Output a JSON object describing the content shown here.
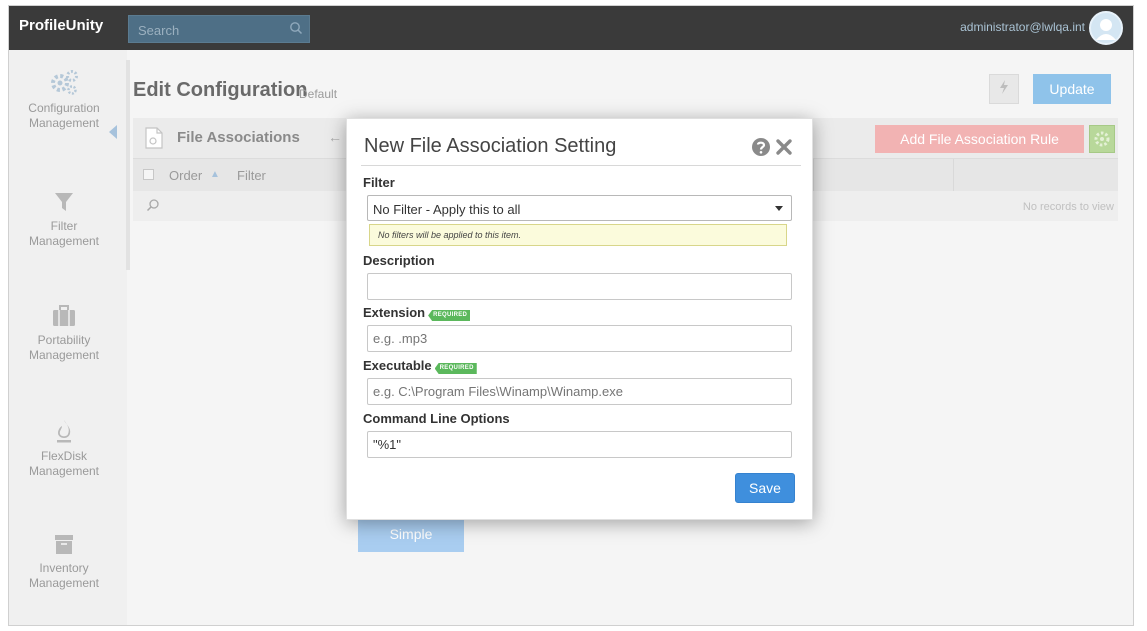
{
  "app": {
    "brand": "ProfileUnity",
    "search_placeholder": "Search",
    "user": "administrator@lwlqa.int"
  },
  "sidebar": {
    "items": [
      {
        "label_line1": "Configuration",
        "label_line2": "Management",
        "icon": "gears-icon"
      },
      {
        "label_line1": "Filter",
        "label_line2": "Management",
        "icon": "funnel-icon"
      },
      {
        "label_line1": "Portability",
        "label_line2": "Management",
        "icon": "briefcase-icon"
      },
      {
        "label_line1": "FlexDisk",
        "label_line2": "Management",
        "icon": "flame-icon"
      },
      {
        "label_line1": "Inventory",
        "label_line2": "Management",
        "icon": "archive-icon"
      }
    ]
  },
  "header": {
    "title": "Edit Configuration",
    "subtitle": "Default",
    "update_label": "Update"
  },
  "panel": {
    "title": "File Associations",
    "add_rule_label": "Add File Association Rule",
    "columns": [
      "Order",
      "Filter"
    ],
    "no_records": "No records to view",
    "simple_label": "Simple"
  },
  "modal": {
    "title": "New File Association Setting",
    "filter_label": "Filter",
    "filter_value": "No Filter - Apply this to all",
    "filter_hint": "No filters will be applied to this item.",
    "description_label": "Description",
    "description_value": "",
    "extension_label": "Extension",
    "extension_placeholder": "e.g. .mp3",
    "executable_label": "Executable",
    "executable_placeholder": "e.g. C:\\Program Files\\Winamp\\Winamp.exe",
    "cmdline_label": "Command Line Options",
    "cmdline_value": "\"%1\"",
    "required_badge": "REQUIRED",
    "save_label": "Save"
  },
  "colors": {
    "topbar": "#3a3a3a",
    "accent_blue": "#3f8fdd",
    "required_green": "#5bb85c",
    "add_rule_red": "#f2b3b3"
  }
}
